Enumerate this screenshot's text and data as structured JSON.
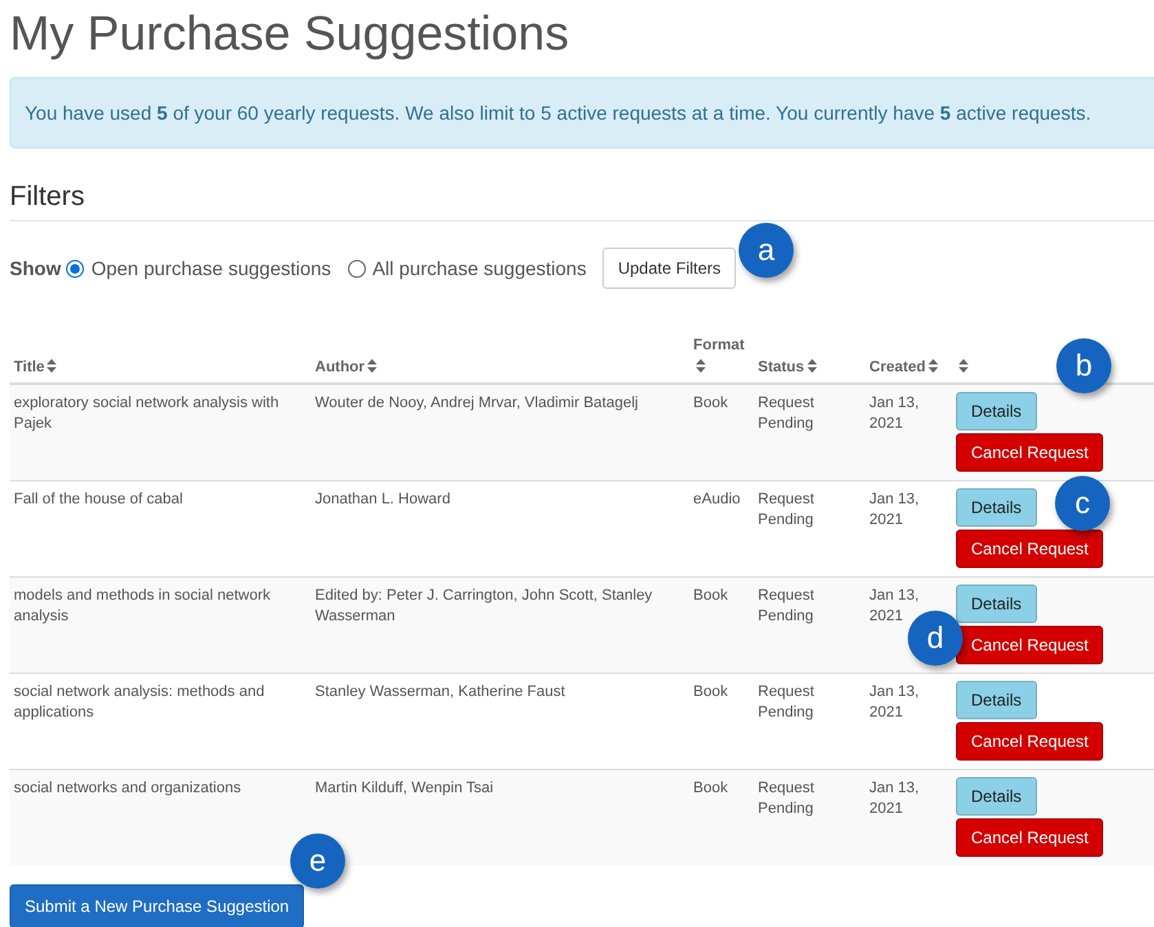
{
  "page": {
    "title": "My Purchase Suggestions"
  },
  "alert": {
    "text": "You have used **5** of your 60 yearly requests. We also limit to 5 active requests at a time. You currently have **5** active requests."
  },
  "filters": {
    "heading": "Filters",
    "show_label": "Show",
    "options": [
      {
        "label": "Open purchase suggestions",
        "selected": true
      },
      {
        "label": "All purchase suggestions",
        "selected": false
      }
    ],
    "button": "Update Filters"
  },
  "table": {
    "columns": [
      {
        "label": "Title",
        "sortable": true
      },
      {
        "label": "Author",
        "sortable": true
      },
      {
        "label": "Format",
        "sortable": true
      },
      {
        "label": "Status",
        "sortable": true
      },
      {
        "label": "Created",
        "sortable": true
      },
      {
        "sortable": true
      }
    ],
    "rows": [
      {
        "title": "exploratory social network analysis with Pajek",
        "author": "Wouter de Nooy, Andrej Mrvar, Vladimir Batagelj",
        "format": "Book",
        "status": "Request Pending",
        "created": "Jan 13, 2021",
        "actions": [
          "Details",
          "Cancel Request"
        ]
      },
      {
        "title": "Fall of the house of cabal",
        "author": "Jonathan L. Howard",
        "format": "eAudio",
        "status": "Request Pending",
        "created": "Jan 13, 2021",
        "actions": [
          "Details",
          "Cancel Request"
        ]
      },
      {
        "title": "models and methods in social network analysis",
        "author": "Edited by: Peter J. Carrington, John Scott, Stanley Wasserman",
        "format": "Book",
        "status": "Request Pending",
        "created": "Jan 13, 2021",
        "actions": [
          "Details",
          "Cancel Request"
        ]
      },
      {
        "title": "social network analysis: methods and applications",
        "author": "Stanley Wasserman, Katherine Faust",
        "format": "Book",
        "status": "Request Pending",
        "created": "Jan 13, 2021",
        "actions": [
          "Details",
          "Cancel Request"
        ]
      },
      {
        "title": "social networks and organizations",
        "author": "Martin Kilduff, Wenpin Tsai",
        "format": "Book",
        "status": "Request Pending",
        "created": "Jan 13, 2021",
        "actions": [
          "Details",
          "Cancel Request"
        ]
      }
    ]
  },
  "submit_button": "Submit a New Purchase Suggestion",
  "annotations": [
    {
      "label": "a"
    },
    {
      "label": "b"
    },
    {
      "label": "c"
    },
    {
      "label": "d"
    },
    {
      "label": "e"
    }
  ]
}
